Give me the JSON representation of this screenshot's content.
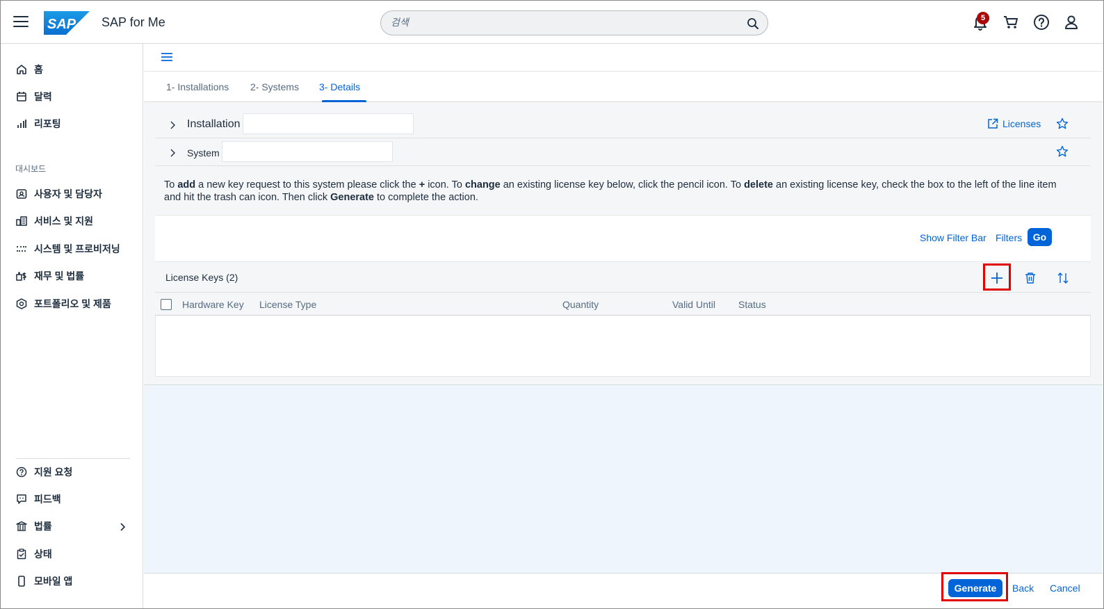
{
  "shell": {
    "app_title": "SAP for Me",
    "logo_text": "SAP",
    "search_placeholder": "검색",
    "notification_count": "5"
  },
  "sidebar": {
    "items": [
      {
        "label": "홈",
        "icon": "home-icon"
      },
      {
        "label": "달력",
        "icon": "calendar-icon"
      },
      {
        "label": "리포팅",
        "icon": "bar-chart-icon"
      }
    ],
    "dashboard_group": "대시보드",
    "dashboard_items": [
      {
        "label": "사용자 및 담당자",
        "icon": "contacts-icon"
      },
      {
        "label": "서비스 및 지원",
        "icon": "services-icon"
      },
      {
        "label": "시스템 및 프로비저닝",
        "icon": "systems-icon"
      },
      {
        "label": "재무 및 법률",
        "icon": "finance-icon"
      },
      {
        "label": "포트폴리오 및 제품",
        "icon": "portfolio-icon"
      }
    ],
    "bottom_items": [
      {
        "label": "지원 요청",
        "icon": "help-icon"
      },
      {
        "label": "피드백",
        "icon": "feedback-icon"
      },
      {
        "label": "법률",
        "icon": "legal-icon"
      },
      {
        "label": "상태",
        "icon": "status-icon"
      },
      {
        "label": "모바일 앱",
        "icon": "mobile-icon"
      }
    ]
  },
  "tabs": [
    {
      "label": "1- Installations",
      "active": false
    },
    {
      "label": "2- Systems",
      "active": false
    },
    {
      "label": "3- Details",
      "active": true
    }
  ],
  "details": {
    "installation_label": "Installation",
    "installation_value": "",
    "system_label": "System",
    "system_value": "",
    "licenses_link": "Licenses"
  },
  "instructions": {
    "t1": "To ",
    "b1": "add",
    "t2": " a new key request to this system please click the ",
    "b2": "+",
    "t3": " icon. To ",
    "b3": "change",
    "t4": " an existing license key below, click the pencil icon. To ",
    "b4": "delete",
    "t5": " an existing license key, check the box to the left of the line item and hit the trash can icon. Then click ",
    "b5": "Generate",
    "t6": " to complete the action."
  },
  "filter_bar": {
    "show_filter_bar": "Show Filter Bar",
    "filters": "Filters",
    "go": "Go"
  },
  "table": {
    "title": "License Keys (2)",
    "columns": [
      "Hardware Key",
      "License Type",
      "Quantity",
      "Valid Until",
      "Status"
    ],
    "rows": []
  },
  "footer": {
    "generate": "Generate",
    "back": "Back",
    "cancel": "Cancel"
  },
  "colors": {
    "accent": "#0064d9",
    "highlight": "#e00000",
    "content_bg": "#eef5fc",
    "badge": "#aa0808"
  }
}
